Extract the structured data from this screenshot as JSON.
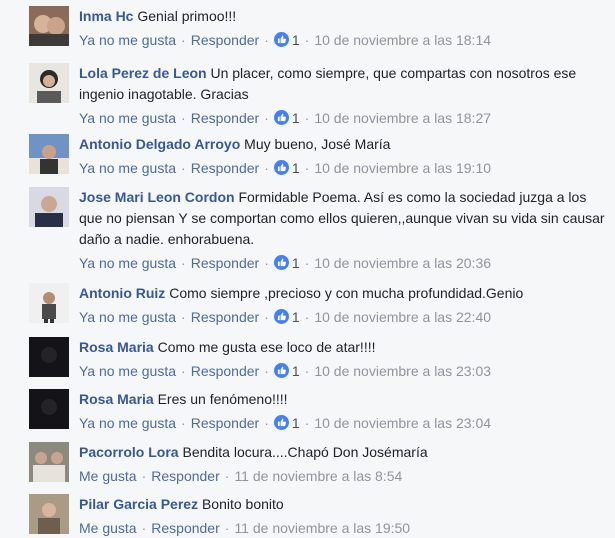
{
  "comments": [
    {
      "author": "Inma Hc",
      "text": "Genial primoo!!!",
      "like_label": "Ya no me gusta",
      "reply_label": "Responder",
      "reactions": "1",
      "date": "10 de noviembre a las 18:14",
      "avatar_colors": [
        "#8a6a58",
        "#3d3a3a"
      ]
    },
    {
      "author": "Lola Perez de Leon",
      "text": "Un placer, como siempre, que compartas con nosotros ese ingenio inagotable. Gracias",
      "like_label": "Ya no me gusta",
      "reply_label": "Responder",
      "reactions": "1",
      "date": "10 de noviembre a las 18:27",
      "avatar_colors": [
        "#e9e6e1",
        "#2b2b2b"
      ]
    },
    {
      "author": "Antonio Delgado Arroyo",
      "text": "Muy bueno, José María",
      "like_label": "Ya no me gusta",
      "reply_label": "Responder",
      "reactions": "1",
      "date": "10 de noviembre a las 19:10",
      "avatar_colors": [
        "#6e93c4",
        "#e9e2d6"
      ]
    },
    {
      "author": "Jose Mari Leon Cordon",
      "text": "Formidable Poema. Así es como la sociedad juzga a los que no piensan Y se comportan como ellos quieren,,aunque vivan su vida sin causar daño a nadie. enhorabuena.",
      "like_label": "Ya no me gusta",
      "reply_label": "Responder",
      "reactions": "1",
      "date": "10 de noviembre a las 20:36",
      "avatar_colors": [
        "#d9d9e3",
        "#2a2f48"
      ]
    },
    {
      "author": "Antonio Ruiz",
      "text": "Como siempre ,precioso y con mucha profundidad.Genio",
      "like_label": "Ya no me gusta",
      "reply_label": "Responder",
      "reactions": "1",
      "date": "10 de noviembre a las 22:40",
      "avatar_colors": [
        "#f0f0f0",
        "#4a4a4a"
      ]
    },
    {
      "author": "Rosa Maria",
      "text": "Como me gusta ese loco de atar!!!!",
      "like_label": "Ya no me gusta",
      "reply_label": "Responder",
      "reactions": "1",
      "date": "10 de noviembre a las 23:03",
      "avatar_colors": [
        "#141418",
        "#232329"
      ]
    },
    {
      "author": "Rosa Maria",
      "text": "Eres un fenómeno!!!!",
      "like_label": "Ya no me gusta",
      "reply_label": "Responder",
      "reactions": "1",
      "date": "10 de noviembre a las 23:04",
      "avatar_colors": [
        "#141418",
        "#232329"
      ]
    },
    {
      "author": "Pacorrolo Lora",
      "text": "Bendita locura....Chapó Don Josémaría",
      "like_label": "Me gusta",
      "reply_label": "Responder",
      "reactions": "",
      "date": "11 de noviembre a las 8:54",
      "avatar_colors": [
        "#8c8a7c",
        "#e7e3dc"
      ]
    },
    {
      "author": "Pilar Garcia Perez",
      "text": "Bonito bonito",
      "like_label": "Me gusta",
      "reply_label": "Responder",
      "reactions": "",
      "date": "11 de noviembre a las 19:50",
      "avatar_colors": [
        "#aa9a86",
        "#6d5e50"
      ]
    }
  ],
  "colors": {
    "author": "#365899",
    "link": "#4b6ba6",
    "meta": "#90949c",
    "like_badge": "#4080ff",
    "background": "#f6f7f9"
  }
}
